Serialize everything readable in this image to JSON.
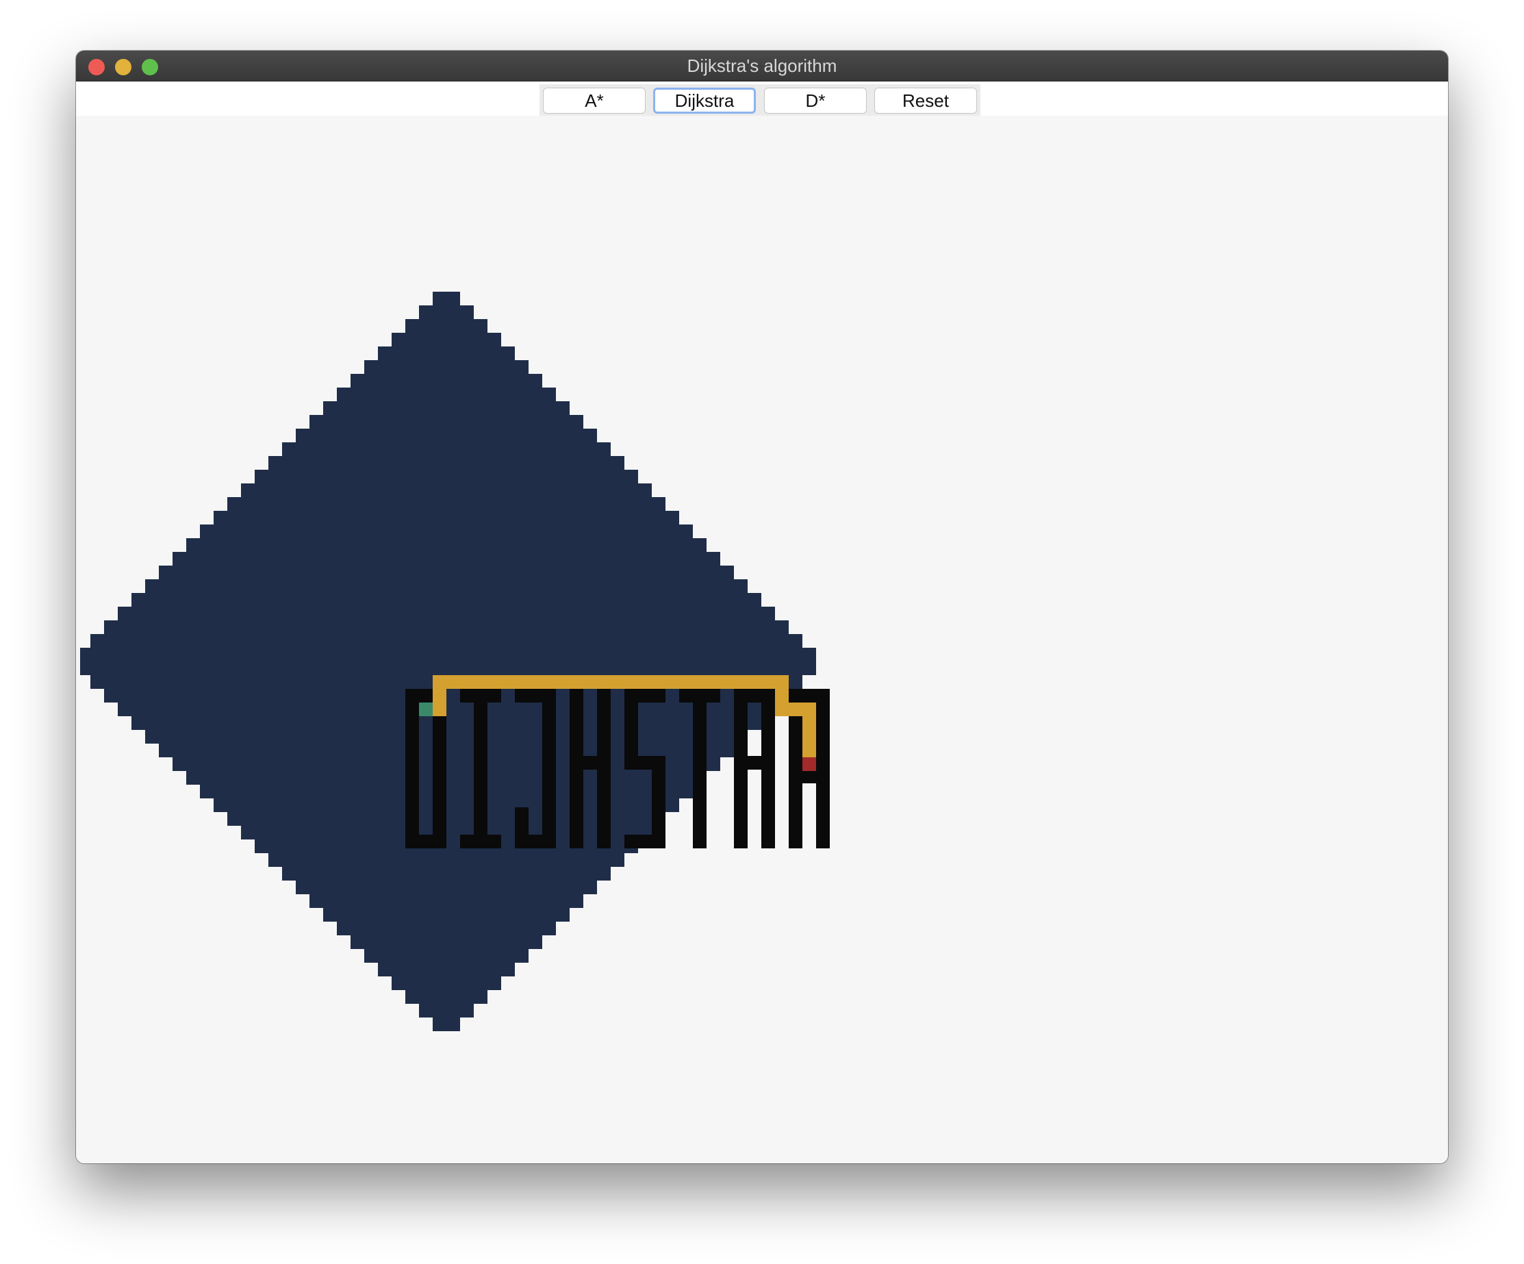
{
  "window": {
    "title": "Dijkstra's algorithm"
  },
  "toolbar": {
    "buttons": [
      {
        "label": "A*"
      },
      {
        "label": "Dijkstra"
      },
      {
        "label": "D*"
      },
      {
        "label": "Reset"
      }
    ]
  },
  "grid": {
    "obstacle_shape": "diamond",
    "wall_text": "DIJKSTRA",
    "colors": {
      "background": "#f6f6f6",
      "obstacle": "#1f2d48",
      "wall": "#0a0a0a",
      "path": "#d4a030",
      "start": "#3a8a6a",
      "goal": "#a32a2a"
    }
  }
}
